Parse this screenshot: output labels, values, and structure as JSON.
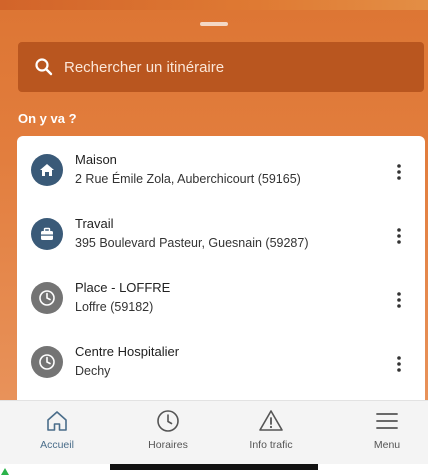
{
  "search": {
    "placeholder": "Rechercher un itinéraire"
  },
  "section": {
    "title": "On y va ?"
  },
  "places": [
    {
      "name": "Maison",
      "address": "2 Rue Émile Zola, Auberchicourt (59165)",
      "icon": "home-icon"
    },
    {
      "name": "Travail",
      "address": "395 Boulevard Pasteur, Guesnain (59287)",
      "icon": "briefcase-icon"
    },
    {
      "name": "Place - LOFFRE",
      "address": "Loffre (59182)",
      "icon": "clock-icon"
    },
    {
      "name": "Centre Hospitalier",
      "address": "Dechy",
      "icon": "clock-icon"
    }
  ],
  "nav": {
    "items": [
      {
        "label": "Accueil",
        "icon": "home-outline-icon"
      },
      {
        "label": "Horaires",
        "icon": "clock-outline-icon"
      },
      {
        "label": "Info trafic",
        "icon": "warning-icon"
      },
      {
        "label": "Menu",
        "icon": "hamburger-icon"
      }
    ]
  },
  "colors": {
    "header": "#dd7634",
    "search_bar": "#b9561f",
    "saved_place": "#3a5a78",
    "recent_place": "#747474",
    "nav_active": "#4a6d8a"
  }
}
